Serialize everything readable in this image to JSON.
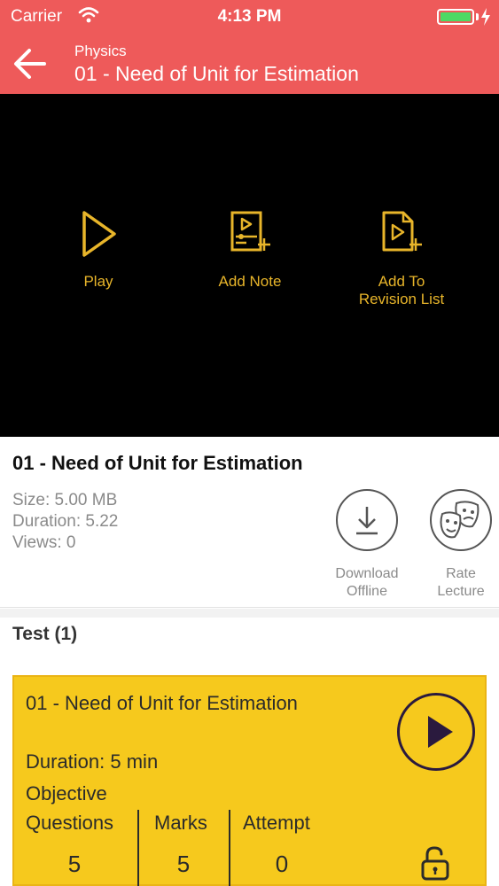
{
  "status_bar": {
    "carrier": "Carrier",
    "time": "4:13 PM"
  },
  "header": {
    "subject": "Physics",
    "title": "01 - Need of Unit for Estimation",
    "background_color": "#ee5a5a"
  },
  "player": {
    "accent_color": "#e8b52a",
    "actions": [
      {
        "label": "Play",
        "icon": "play-outline-icon"
      },
      {
        "label": "Add Note",
        "icon": "add-note-icon"
      },
      {
        "label": "Add To Revision List",
        "icon": "add-revision-icon"
      }
    ]
  },
  "lecture": {
    "title": "01 - Need of Unit for Estimation",
    "size": "Size: 5.00 MB",
    "duration": "Duration: 5.22",
    "views": "Views: 0",
    "download_label_1": "Download",
    "download_label_2": "Offline",
    "rate_label_1": "Rate",
    "rate_label_2": "Lecture"
  },
  "tests": {
    "section_title": "Test (1)",
    "card_color": "#f6c91d",
    "items": [
      {
        "title": "01 - Need of Unit for Estimation",
        "duration": "Duration:  5 min",
        "type": "Objective",
        "columns": [
          {
            "label": "Questions",
            "value": "5"
          },
          {
            "label": "Marks",
            "value": "5"
          },
          {
            "label": "Attempt",
            "value": "0"
          }
        ]
      }
    ]
  }
}
